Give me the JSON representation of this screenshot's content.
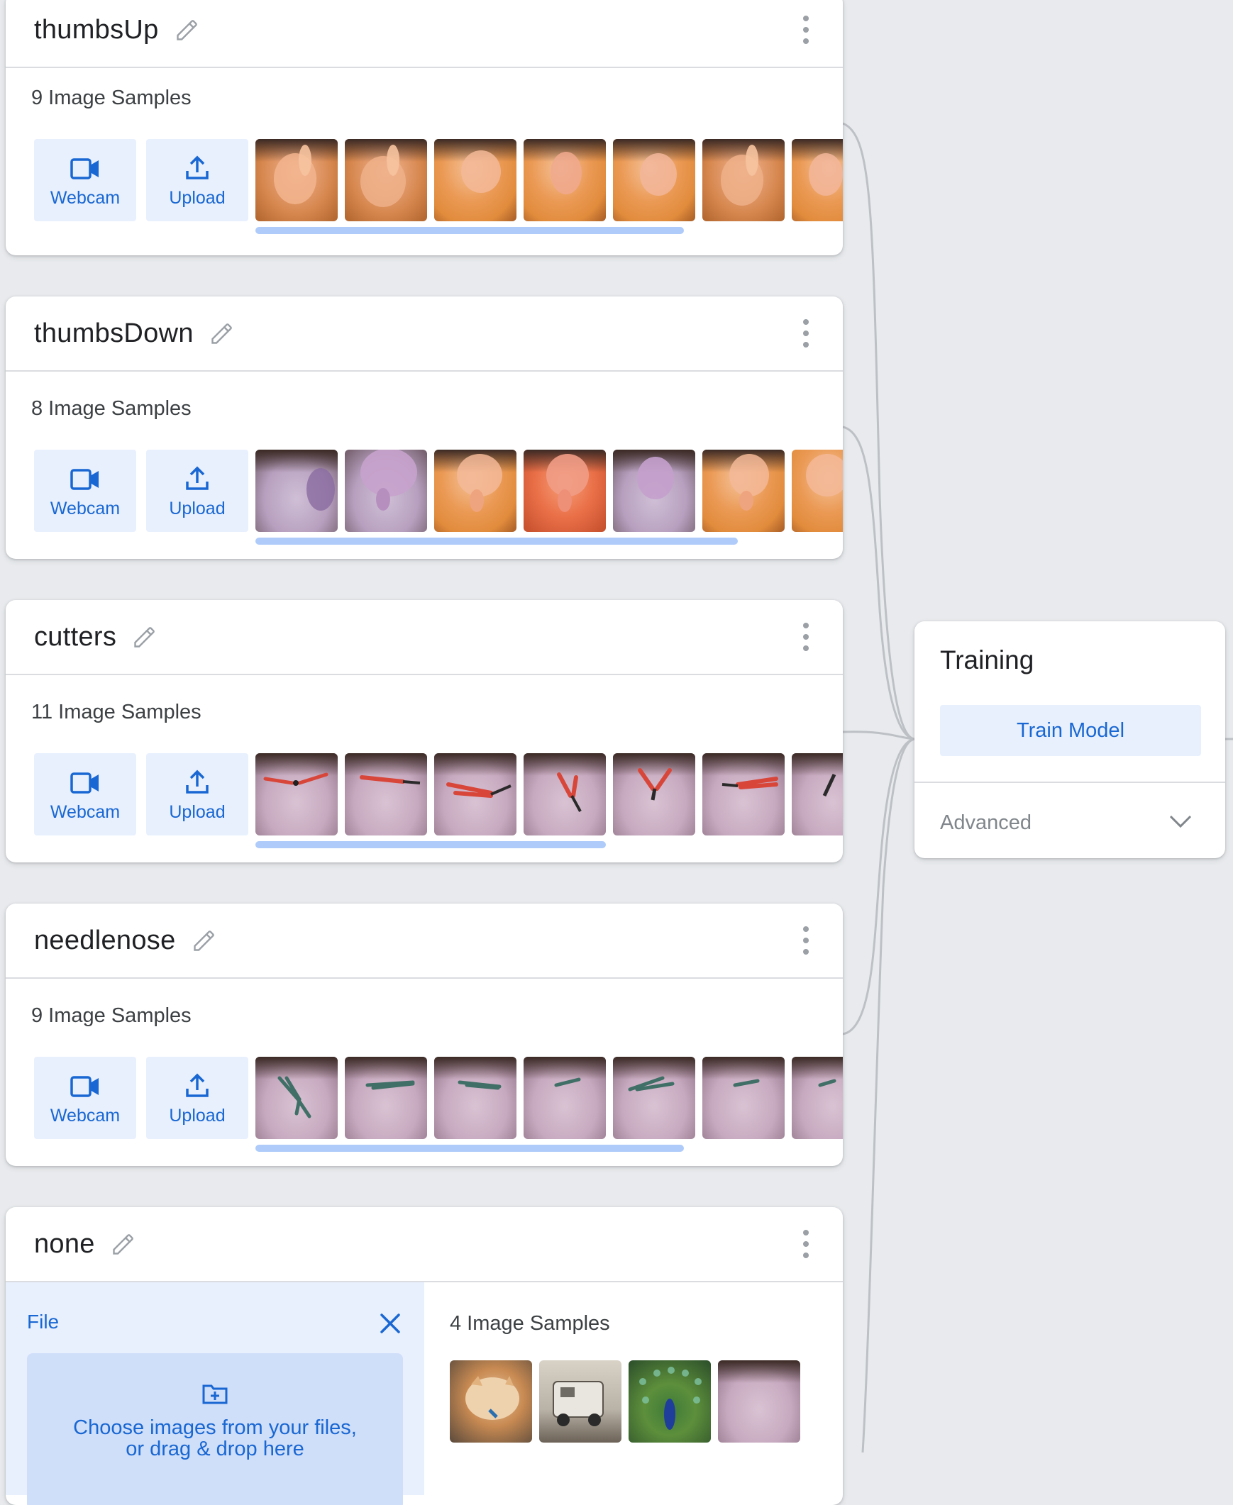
{
  "classes": [
    {
      "name": "thumbsUp",
      "samples_label": "9 Image Samples",
      "webcam_label": "Webcam",
      "upload_label": "Upload",
      "thumbnail_style": "hand",
      "scroll_fraction": 0.73
    },
    {
      "name": "thumbsDown",
      "samples_label": "8 Image Samples",
      "webcam_label": "Webcam",
      "upload_label": "Upload",
      "thumbnail_style": "hand-down",
      "scroll_fraction": 0.82
    },
    {
      "name": "cutters",
      "samples_label": "11 Image Samples",
      "webcam_label": "Webcam",
      "upload_label": "Upload",
      "thumbnail_style": "red-cutters",
      "scroll_fraction": 0.6
    },
    {
      "name": "needlenose",
      "samples_label": "9 Image Samples",
      "webcam_label": "Webcam",
      "upload_label": "Upload",
      "thumbnail_style": "green-pliers",
      "scroll_fraction": 0.73
    },
    {
      "name": "none",
      "samples_label": "4 Image Samples",
      "upload_panel": {
        "title": "File",
        "dropzone_line1": "Choose images from your files,",
        "dropzone_line2": "or drag & drop here"
      },
      "thumbnails": [
        "cat-photo",
        "toy-truck-photo",
        "peacock-photo",
        "floor-photo"
      ]
    }
  ],
  "training": {
    "title": "Training",
    "train_button": "Train Model",
    "advanced_label": "Advanced"
  },
  "colors": {
    "background": "#e8eaed",
    "card": "#ffffff",
    "accent": "#1967d2",
    "button_bg": "#e8f0fe",
    "scrollbar": "#aecbfa",
    "connector": "#bdc1c6"
  },
  "icons": [
    "pencil-icon",
    "more-vert-icon",
    "webcam-icon",
    "upload-icon",
    "close-icon",
    "folder-add-icon",
    "chevron-down-icon"
  ]
}
